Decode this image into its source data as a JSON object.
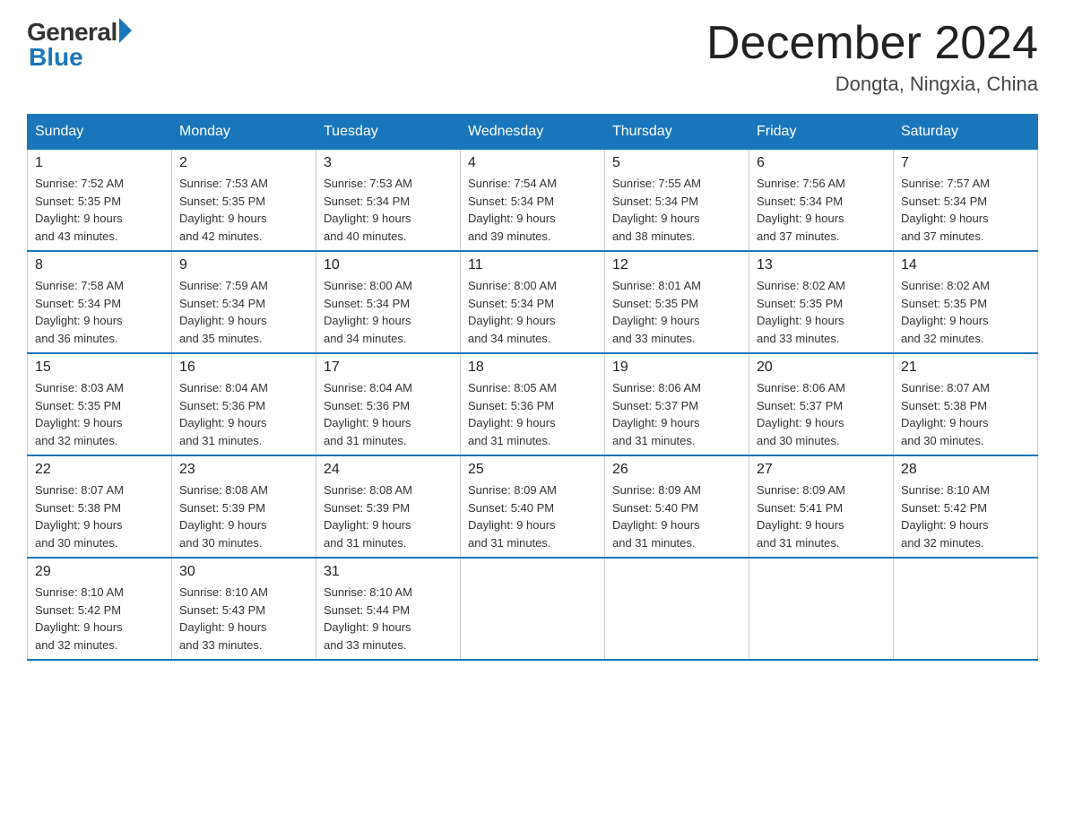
{
  "header": {
    "logo_general": "General",
    "logo_blue": "Blue",
    "month_title": "December 2024",
    "location": "Dongta, Ningxia, China"
  },
  "days_of_week": [
    "Sunday",
    "Monday",
    "Tuesday",
    "Wednesday",
    "Thursday",
    "Friday",
    "Saturday"
  ],
  "weeks": [
    [
      {
        "day": "1",
        "sunrise": "7:52 AM",
        "sunset": "5:35 PM",
        "daylight": "9 hours and 43 minutes."
      },
      {
        "day": "2",
        "sunrise": "7:53 AM",
        "sunset": "5:35 PM",
        "daylight": "9 hours and 42 minutes."
      },
      {
        "day": "3",
        "sunrise": "7:53 AM",
        "sunset": "5:34 PM",
        "daylight": "9 hours and 40 minutes."
      },
      {
        "day": "4",
        "sunrise": "7:54 AM",
        "sunset": "5:34 PM",
        "daylight": "9 hours and 39 minutes."
      },
      {
        "day": "5",
        "sunrise": "7:55 AM",
        "sunset": "5:34 PM",
        "daylight": "9 hours and 38 minutes."
      },
      {
        "day": "6",
        "sunrise": "7:56 AM",
        "sunset": "5:34 PM",
        "daylight": "9 hours and 37 minutes."
      },
      {
        "day": "7",
        "sunrise": "7:57 AM",
        "sunset": "5:34 PM",
        "daylight": "9 hours and 37 minutes."
      }
    ],
    [
      {
        "day": "8",
        "sunrise": "7:58 AM",
        "sunset": "5:34 PM",
        "daylight": "9 hours and 36 minutes."
      },
      {
        "day": "9",
        "sunrise": "7:59 AM",
        "sunset": "5:34 PM",
        "daylight": "9 hours and 35 minutes."
      },
      {
        "day": "10",
        "sunrise": "8:00 AM",
        "sunset": "5:34 PM",
        "daylight": "9 hours and 34 minutes."
      },
      {
        "day": "11",
        "sunrise": "8:00 AM",
        "sunset": "5:34 PM",
        "daylight": "9 hours and 34 minutes."
      },
      {
        "day": "12",
        "sunrise": "8:01 AM",
        "sunset": "5:35 PM",
        "daylight": "9 hours and 33 minutes."
      },
      {
        "day": "13",
        "sunrise": "8:02 AM",
        "sunset": "5:35 PM",
        "daylight": "9 hours and 33 minutes."
      },
      {
        "day": "14",
        "sunrise": "8:02 AM",
        "sunset": "5:35 PM",
        "daylight": "9 hours and 32 minutes."
      }
    ],
    [
      {
        "day": "15",
        "sunrise": "8:03 AM",
        "sunset": "5:35 PM",
        "daylight": "9 hours and 32 minutes."
      },
      {
        "day": "16",
        "sunrise": "8:04 AM",
        "sunset": "5:36 PM",
        "daylight": "9 hours and 31 minutes."
      },
      {
        "day": "17",
        "sunrise": "8:04 AM",
        "sunset": "5:36 PM",
        "daylight": "9 hours and 31 minutes."
      },
      {
        "day": "18",
        "sunrise": "8:05 AM",
        "sunset": "5:36 PM",
        "daylight": "9 hours and 31 minutes."
      },
      {
        "day": "19",
        "sunrise": "8:06 AM",
        "sunset": "5:37 PM",
        "daylight": "9 hours and 31 minutes."
      },
      {
        "day": "20",
        "sunrise": "8:06 AM",
        "sunset": "5:37 PM",
        "daylight": "9 hours and 30 minutes."
      },
      {
        "day": "21",
        "sunrise": "8:07 AM",
        "sunset": "5:38 PM",
        "daylight": "9 hours and 30 minutes."
      }
    ],
    [
      {
        "day": "22",
        "sunrise": "8:07 AM",
        "sunset": "5:38 PM",
        "daylight": "9 hours and 30 minutes."
      },
      {
        "day": "23",
        "sunrise": "8:08 AM",
        "sunset": "5:39 PM",
        "daylight": "9 hours and 30 minutes."
      },
      {
        "day": "24",
        "sunrise": "8:08 AM",
        "sunset": "5:39 PM",
        "daylight": "9 hours and 31 minutes."
      },
      {
        "day": "25",
        "sunrise": "8:09 AM",
        "sunset": "5:40 PM",
        "daylight": "9 hours and 31 minutes."
      },
      {
        "day": "26",
        "sunrise": "8:09 AM",
        "sunset": "5:40 PM",
        "daylight": "9 hours and 31 minutes."
      },
      {
        "day": "27",
        "sunrise": "8:09 AM",
        "sunset": "5:41 PM",
        "daylight": "9 hours and 31 minutes."
      },
      {
        "day": "28",
        "sunrise": "8:10 AM",
        "sunset": "5:42 PM",
        "daylight": "9 hours and 32 minutes."
      }
    ],
    [
      {
        "day": "29",
        "sunrise": "8:10 AM",
        "sunset": "5:42 PM",
        "daylight": "9 hours and 32 minutes."
      },
      {
        "day": "30",
        "sunrise": "8:10 AM",
        "sunset": "5:43 PM",
        "daylight": "9 hours and 33 minutes."
      },
      {
        "day": "31",
        "sunrise": "8:10 AM",
        "sunset": "5:44 PM",
        "daylight": "9 hours and 33 minutes."
      },
      null,
      null,
      null,
      null
    ]
  ]
}
